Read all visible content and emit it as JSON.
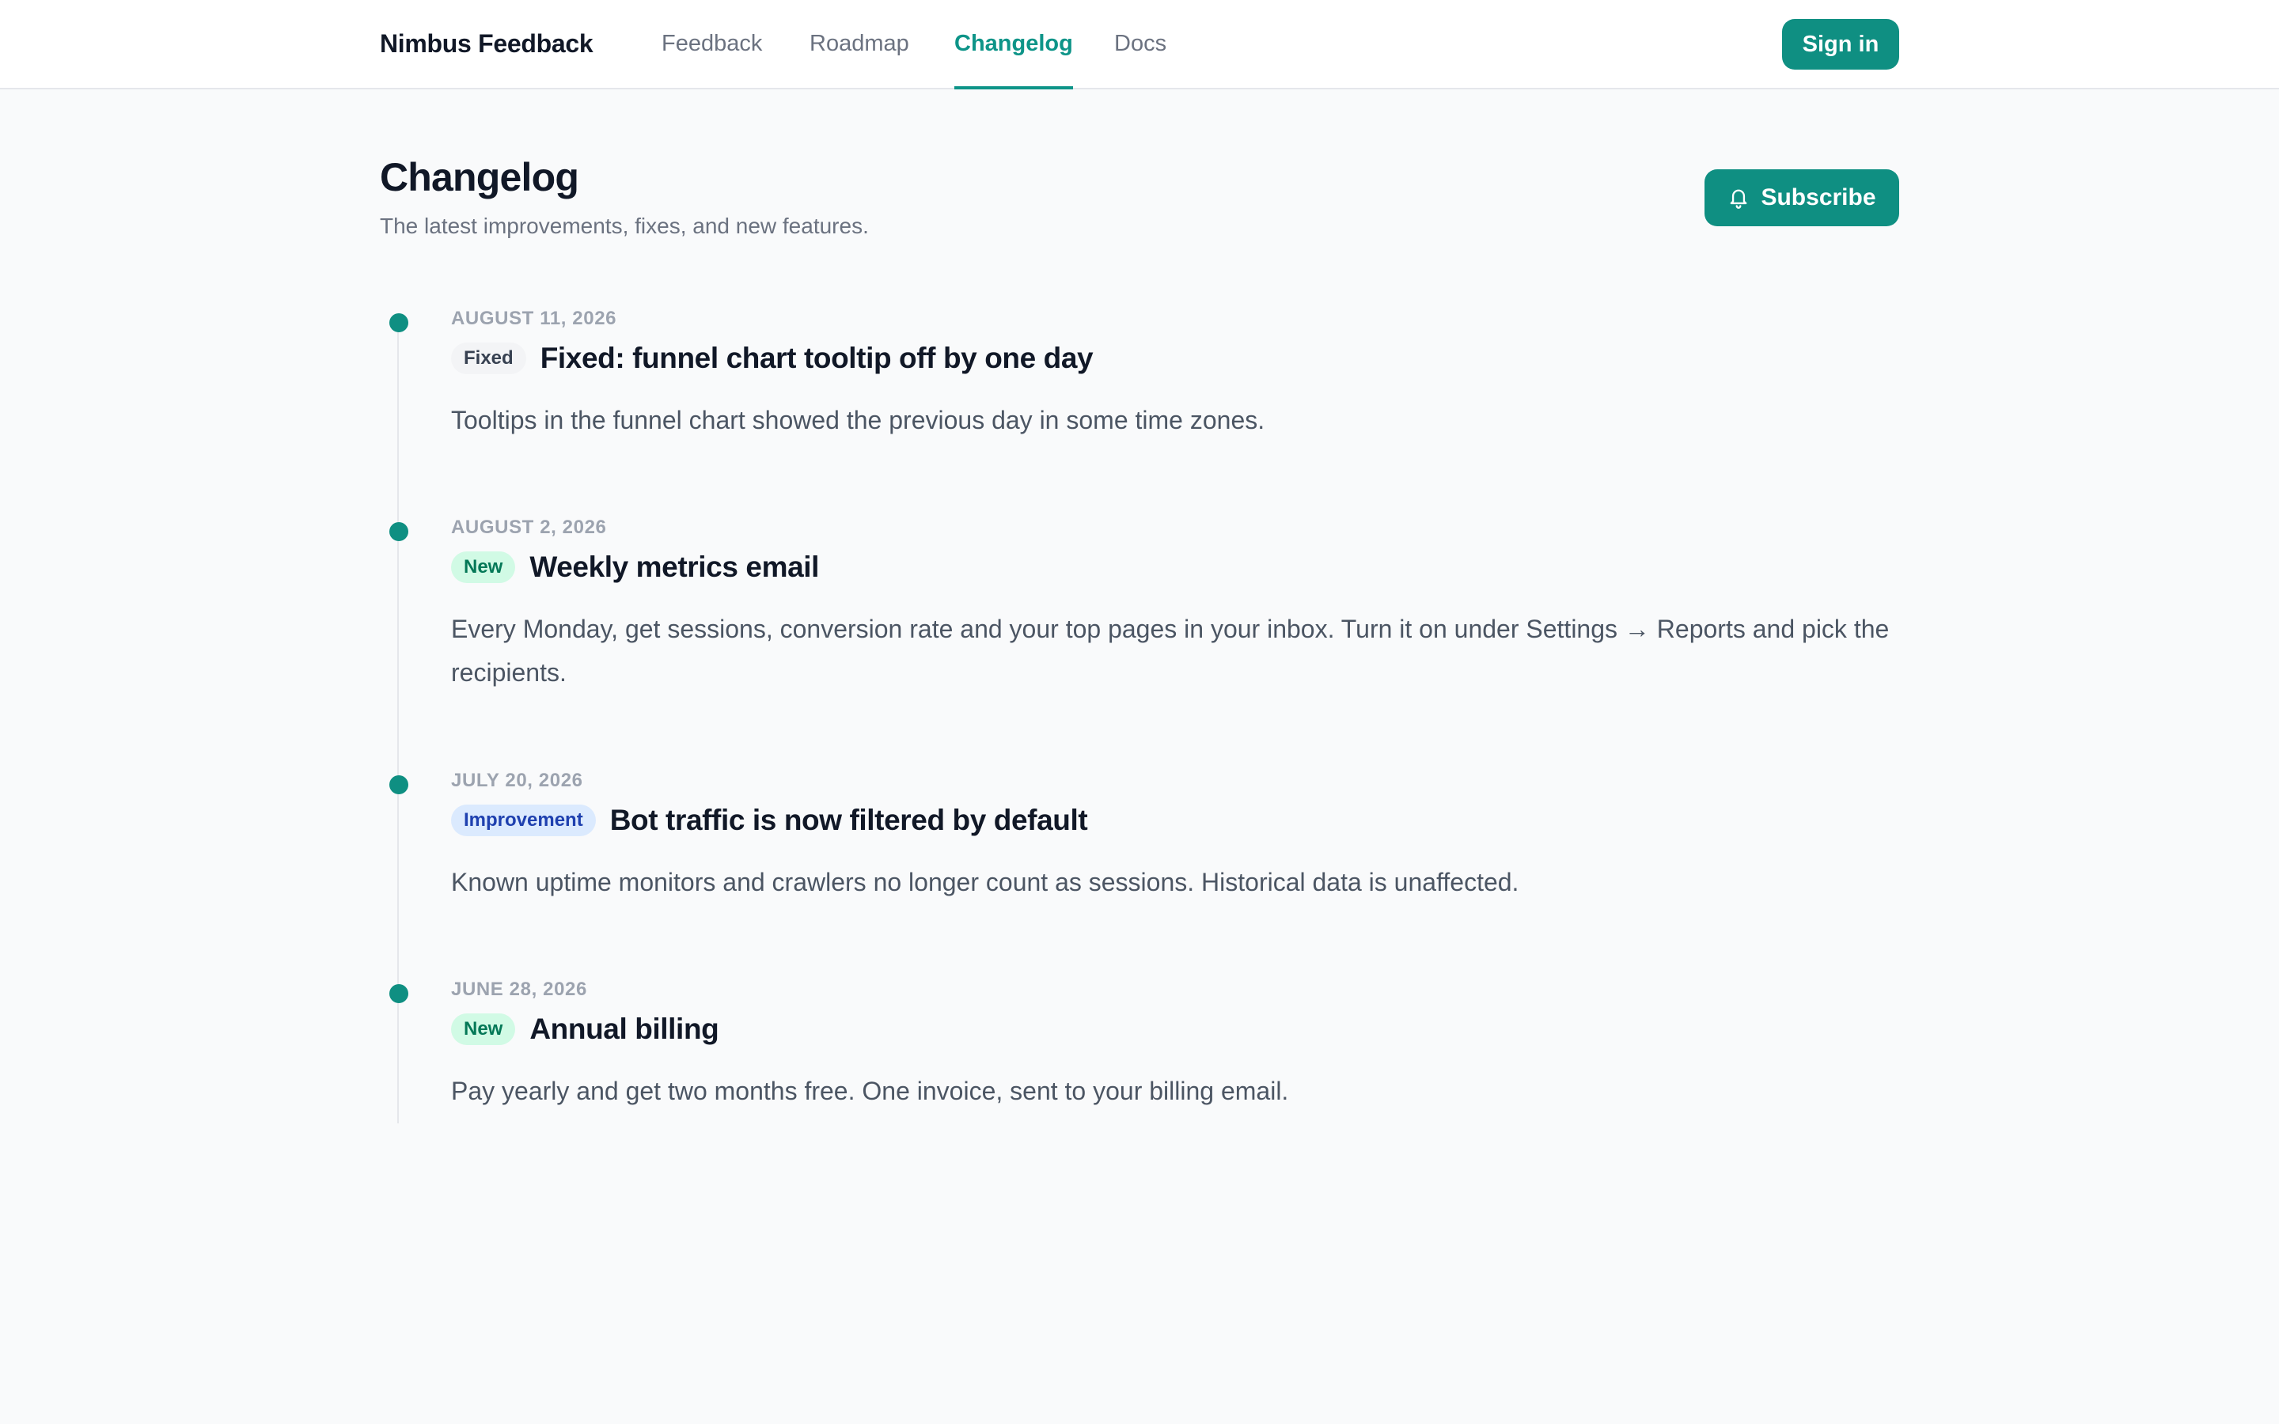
{
  "brand": "Nimbus Feedback",
  "nav": [
    {
      "label": "Feedback",
      "active": false
    },
    {
      "label": "Roadmap",
      "active": false
    },
    {
      "label": "Changelog",
      "active": true
    },
    {
      "label": "Docs",
      "active": false
    }
  ],
  "auth": {
    "sign_in_label": "Sign in"
  },
  "page": {
    "title": "Changelog",
    "subtitle": "The latest improvements, fixes, and new features.",
    "subscribe_label": "Subscribe",
    "subscribe_icon": "bell-icon"
  },
  "entries": [
    {
      "date": "AUGUST 11, 2026",
      "tag": "Fixed",
      "title": "Fixed: funnel chart tooltip off by one day",
      "body": "Tooltips in the funnel chart showed the previous day in some time zones."
    },
    {
      "date": "AUGUST 2, 2026",
      "tag": "New",
      "title": "Weekly metrics email",
      "body": "Every Monday, get sessions, conversion rate and your top pages in your inbox. Turn it on under Settings → Reports and pick the recipients."
    },
    {
      "date": "JULY 20, 2026",
      "tag": "Improvement",
      "title": "Bot traffic is now filtered by default",
      "body": "Known uptime monitors and crawlers no longer count as sessions. Historical data is unaffected."
    },
    {
      "date": "JUNE 28, 2026",
      "tag": "New",
      "title": "Annual billing",
      "body": "Pay yearly and get two months free. One invoice, sent to your billing email."
    }
  ],
  "colors": {
    "accent": "#0f8f82",
    "tag_fixed_bg": "#f3f4f6",
    "tag_new_bg": "#d1fae5",
    "tag_improvement_bg": "#dbeafe"
  }
}
